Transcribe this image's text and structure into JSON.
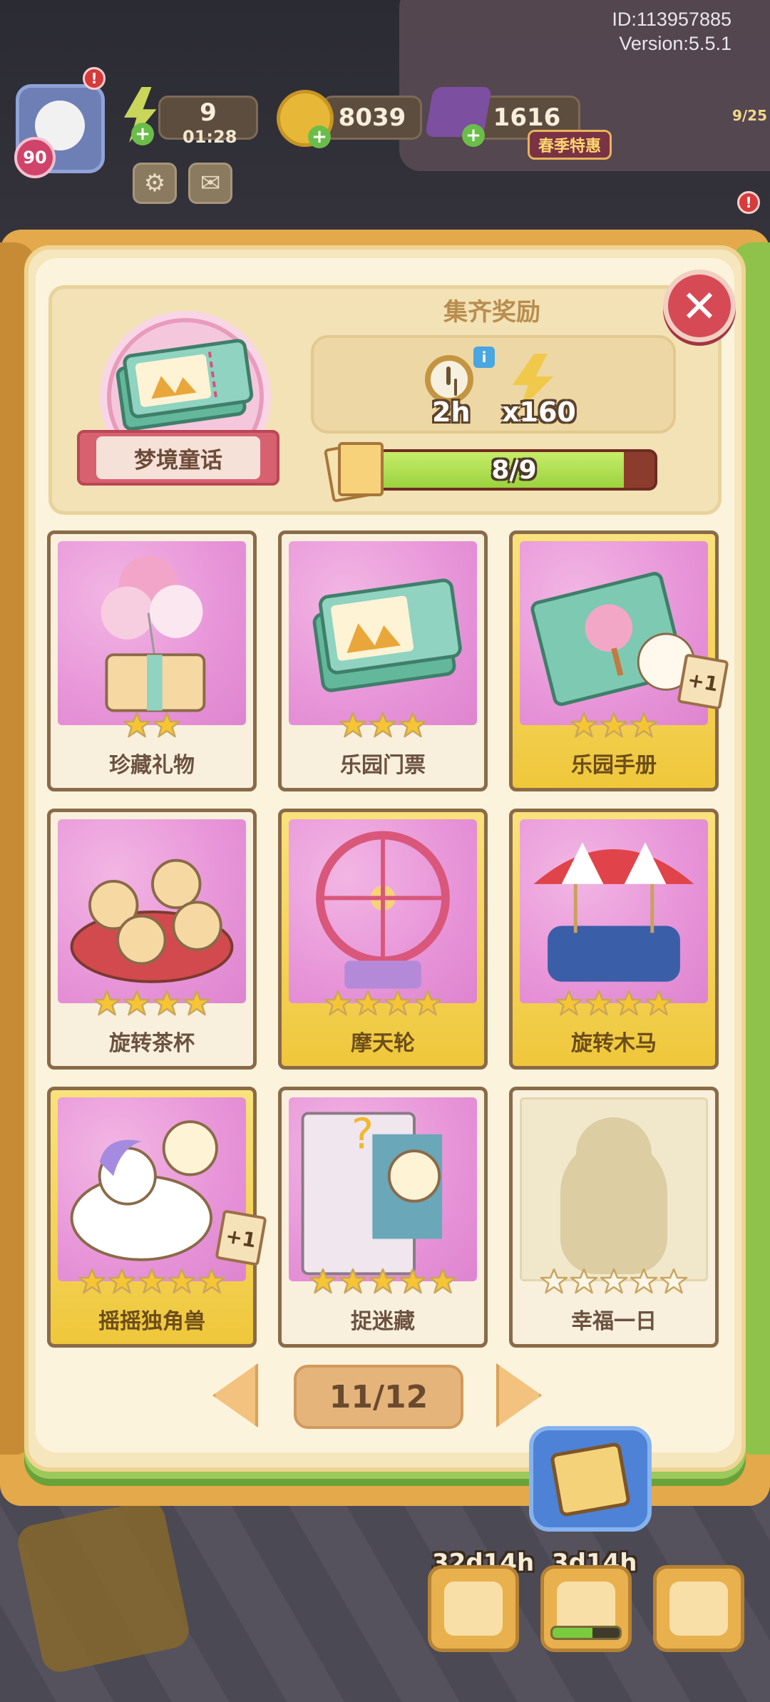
{
  "hud": {
    "player_id": "ID:113957885",
    "version": "Version:5.5.1",
    "level": "90",
    "energy_value": "9",
    "energy_timer": "01:28",
    "coins": "8039",
    "gems": "1616",
    "season_tag": "春季特惠",
    "side_counter": "9/25",
    "alert_mark": "!"
  },
  "album": {
    "name": "梦境童话",
    "reward_title": "集齐奖励",
    "reward_time": "2h",
    "reward_energy": "x160",
    "progress_label": "8/9",
    "progress_fraction": 0.89,
    "info_mark": "i",
    "close_symbol": "✕"
  },
  "cards": [
    {
      "name": "珍藏礼物",
      "stars": 2,
      "max_stars": 2,
      "tier": "plain",
      "plus_one": false,
      "locked": false
    },
    {
      "name": "乐园门票",
      "stars": 3,
      "max_stars": 3,
      "tier": "plain",
      "plus_one": false,
      "locked": false
    },
    {
      "name": "乐园手册",
      "stars": 3,
      "max_stars": 3,
      "tier": "gold",
      "plus_one": true,
      "locked": false
    },
    {
      "name": "旋转茶杯",
      "stars": 4,
      "max_stars": 4,
      "tier": "plain",
      "plus_one": false,
      "locked": false
    },
    {
      "name": "摩天轮",
      "stars": 4,
      "max_stars": 4,
      "tier": "gold",
      "plus_one": false,
      "locked": false
    },
    {
      "name": "旋转木马",
      "stars": 4,
      "max_stars": 4,
      "tier": "gold",
      "plus_one": false,
      "locked": false
    },
    {
      "name": "摇摇独角兽",
      "stars": 5,
      "max_stars": 5,
      "tier": "gold",
      "plus_one": true,
      "locked": false
    },
    {
      "name": "捉迷藏",
      "stars": 5,
      "max_stars": 5,
      "tier": "plain",
      "plus_one": false,
      "locked": false
    },
    {
      "name": "幸福一日",
      "stars": 0,
      "max_stars": 5,
      "tier": "plain",
      "plus_one": false,
      "locked": true
    }
  ],
  "plus_one_label": "+1",
  "pager": {
    "label": "11/12"
  },
  "dock": {
    "timer_left": "32d14h",
    "timer_right": "3d14h",
    "right_progress_fraction": 0.6
  },
  "colors": {
    "star_filled": "#f6c533",
    "star_empty": "#fbf6e8",
    "gold_card": "#efc73b",
    "pink_art": "#e794d8",
    "close_red": "#d64a55",
    "progress_green": "#9bd33f"
  }
}
